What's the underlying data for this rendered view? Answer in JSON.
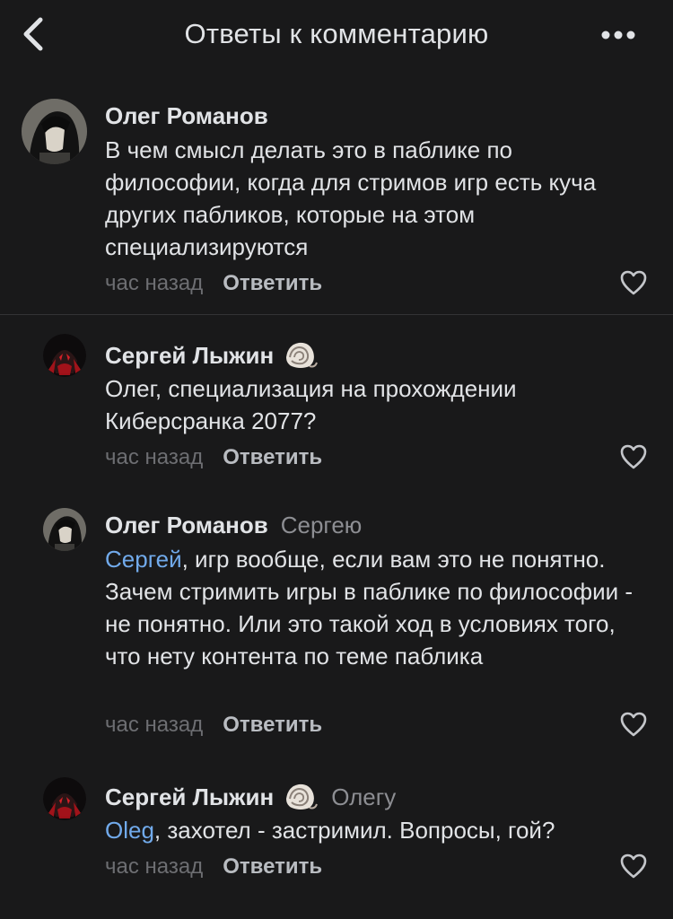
{
  "header": {
    "title": "Ответы к комментарию",
    "back_icon": "chevron-left-icon",
    "more_icon": "more-horizontal-icon"
  },
  "comments": [
    {
      "author": "Олег Романов",
      "reply_to": "",
      "mention": "",
      "text": "В чем смысл делать это в паблике по философии, когда для стримов игр есть куча других пабликов, которые на этом специализируются",
      "time": "час назад",
      "reply_label": "Ответить"
    },
    {
      "author": "Сергей Лыжин",
      "badge_icon": "shell-icon",
      "reply_to": "",
      "mention": "",
      "text": "Олег, специализация на прохождении Киберсранка 2077?",
      "time": "час назад",
      "reply_label": "Ответить"
    },
    {
      "author": "Олег Романов",
      "reply_to": "Сергею",
      "mention": "Сергей",
      "text": ", игр вообще, если вам это не понятно. Зачем стримить игры в паблике по философии  - не понятно. Или это такой ход в условиях того, что нету контента по теме паблика",
      "time": "час назад",
      "reply_label": "Ответить"
    },
    {
      "author": "Сергей Лыжин",
      "badge_icon": "shell-icon",
      "reply_to": "Олегу",
      "mention": "Oleg",
      "text": ", захотел - застримил. Вопросы, гой?",
      "time": "час назад",
      "reply_label": "Ответить"
    }
  ],
  "colors": {
    "background": "#19191a",
    "text": "#e1e3e6",
    "secondary": "#6d6e72",
    "mention": "#71aaeb"
  }
}
